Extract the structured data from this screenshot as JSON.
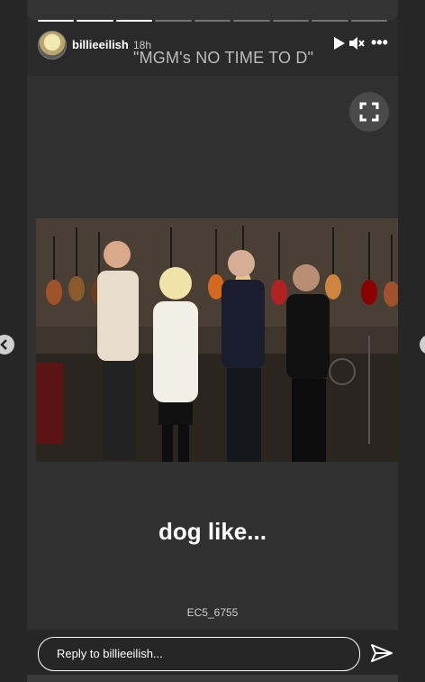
{
  "story": {
    "username": "billieeilish",
    "time": "18h",
    "overlay_title": "\"MGM's NO TIME TO D\"",
    "caption": "dog like...",
    "photo_credit": "EC5_6755",
    "progress": {
      "segments": 9,
      "completed": 3
    }
  },
  "reply": {
    "placeholder": "Reply to billieeilish..."
  },
  "icons": {
    "play": "play-icon",
    "mute": "mute-icon",
    "more": "more-options-icon",
    "expand": "expand-icon",
    "send": "send-icon",
    "nav_left": "chevron-left-icon",
    "nav_right": "chevron-right-icon"
  },
  "colors": {
    "background": "#262626",
    "story_bg": "#303030",
    "text": "#ffffff"
  }
}
